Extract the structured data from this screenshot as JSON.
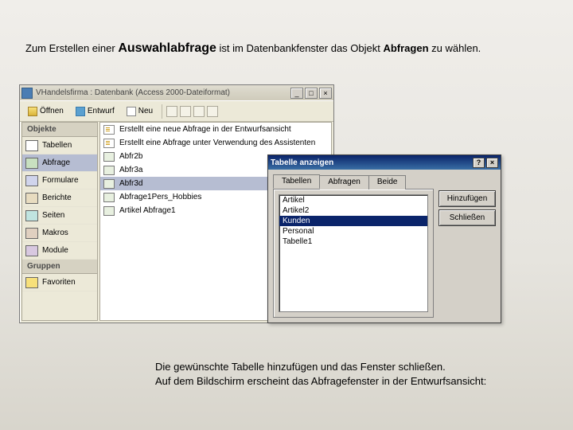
{
  "instruction_top": {
    "part1": "Zum Erstellen einer ",
    "bigword": "Auswahlabfrage",
    "part2": " ist im Datenbankfenster das Objekt ",
    "bold": "Abfragen",
    "part3": " zu wählen."
  },
  "instruction_bottom": {
    "line1": "Die gewünschte Tabelle hinzufügen und das Fenster schließen.",
    "line2": "Auf dem Bildschirm erscheint das Abfragefenster in der Entwurfsansicht:"
  },
  "dbwindow": {
    "title": "VHandelsfirma : Datenbank (Access 2000-Dateiformat)",
    "toolbar": {
      "open": "Öffnen",
      "design": "Entwurf",
      "new": "Neu"
    },
    "nav": {
      "header_objects": "Objekte",
      "items": [
        {
          "label": "Tabellen",
          "ic": "nic-tables"
        },
        {
          "label": "Abfrage",
          "ic": "nic-queries"
        },
        {
          "label": "Formulare",
          "ic": "nic-forms"
        },
        {
          "label": "Berichte",
          "ic": "nic-reports"
        },
        {
          "label": "Seiten",
          "ic": "nic-pages"
        },
        {
          "label": "Makros",
          "ic": "nic-macros"
        },
        {
          "label": "Module",
          "ic": "nic-modules"
        }
      ],
      "header_groups": "Gruppen",
      "favorites": "Favoriten"
    },
    "list": {
      "items": [
        {
          "label": "Erstellt eine neue Abfrage in der Entwurfsansicht",
          "ic": "lic-new",
          "sel": false
        },
        {
          "label": "Erstellt eine Abfrage unter Verwendung des Assistenten",
          "ic": "lic-new",
          "sel": false
        },
        {
          "label": "Abfr2b",
          "ic": "lic-q",
          "sel": false
        },
        {
          "label": "Abfr3a",
          "ic": "lic-q",
          "sel": false
        },
        {
          "label": "Abfr3d",
          "ic": "lic-q",
          "sel": true
        },
        {
          "label": "Abfrage1Pers_Hobbies",
          "ic": "lic-q",
          "sel": false
        },
        {
          "label": "Artikel Abfrage1",
          "ic": "lic-q",
          "sel": false
        }
      ]
    }
  },
  "dialog": {
    "title": "Tabelle anzeigen",
    "tabs": {
      "tables": "Tabellen",
      "queries": "Abfragen",
      "both": "Beide"
    },
    "buttons": {
      "add": "Hinzufügen",
      "close": "Schließen"
    },
    "listbox": [
      {
        "label": "Artikel",
        "sel": false
      },
      {
        "label": "Artikel2",
        "sel": false
      },
      {
        "label": "Kunden",
        "sel": true
      },
      {
        "label": "Personal",
        "sel": false
      },
      {
        "label": "Tabelle1",
        "sel": false
      }
    ]
  }
}
